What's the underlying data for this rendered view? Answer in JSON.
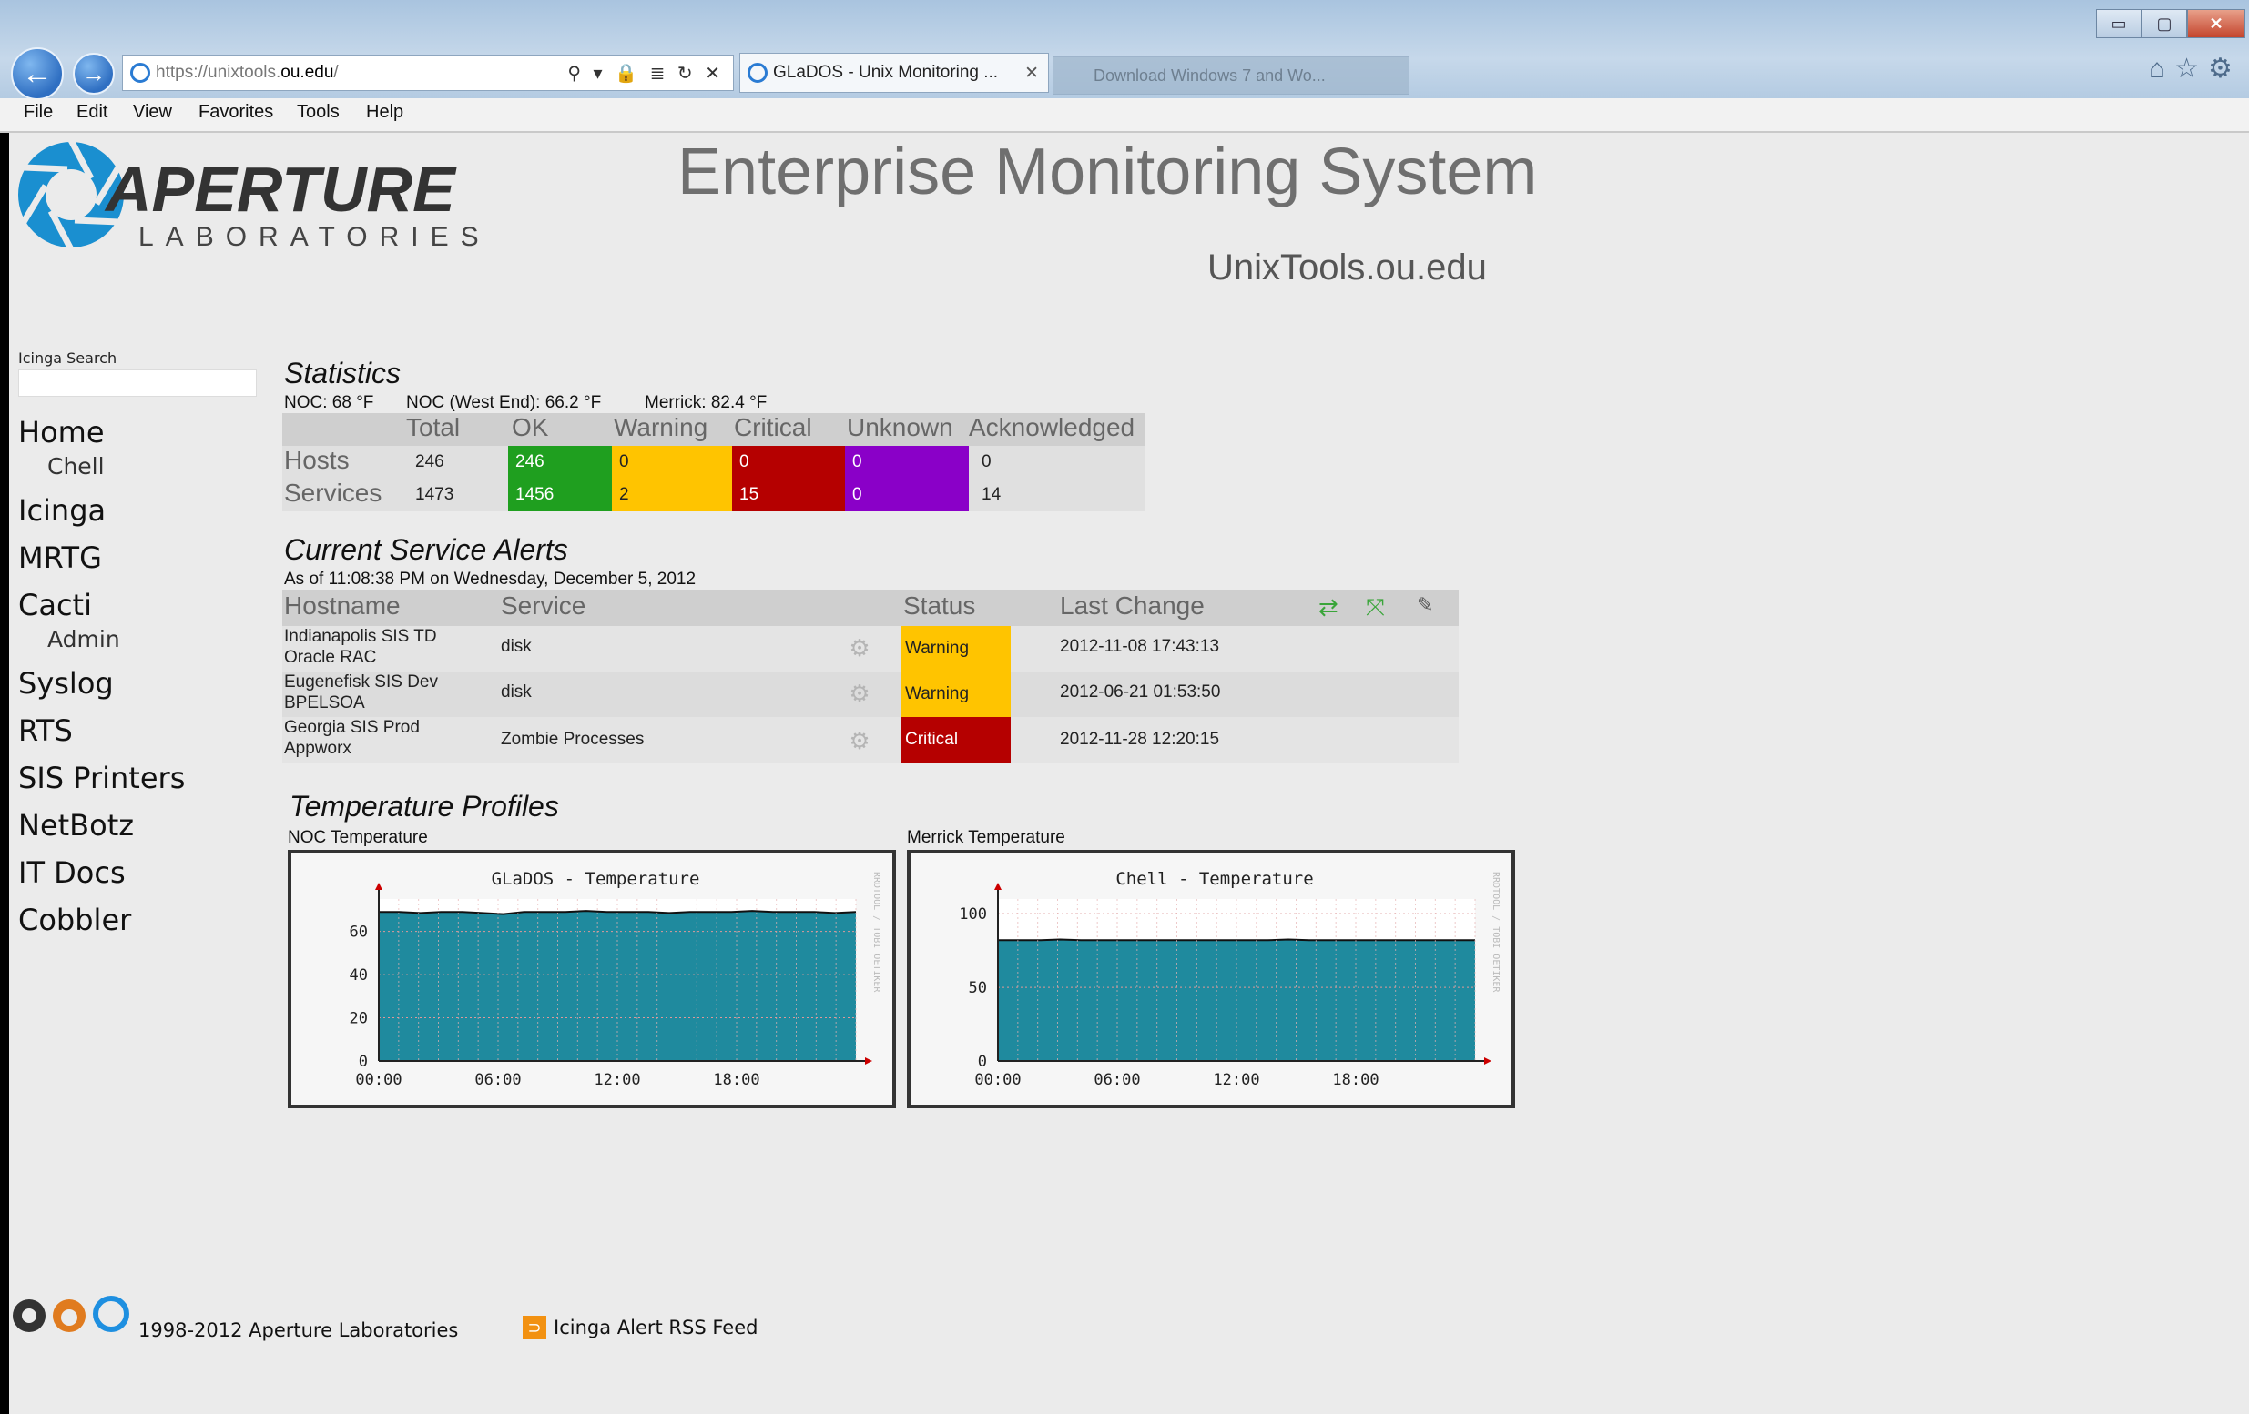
{
  "browser": {
    "url_prefix": "https://unixtools.",
    "url_domain": "ou.edu",
    "url_suffix": "/",
    "address_icons": "⚲ ▾ 🔒 ≣ ↻ ✕",
    "active_tab": "GLaDOS - Unix Monitoring ...",
    "other_tab": "Download Windows 7 and Wo...",
    "menu": [
      "File",
      "Edit",
      "View",
      "Favorites",
      "Tools",
      "Help"
    ],
    "window_buttons": [
      "▭",
      "▢",
      "✕"
    ],
    "toolbar_icons": [
      "home-icon",
      "star-icon",
      "gear-icon"
    ]
  },
  "logo": {
    "word1": "APERTURE",
    "word2": "LABORATORIES"
  },
  "header": {
    "title": "Enterprise Monitoring System",
    "subtitle": "UnixTools.ou.edu"
  },
  "sidebar": {
    "search_label": "Icinga Search",
    "search_value": "",
    "items": [
      {
        "label": "Home"
      },
      {
        "label": "Chell"
      },
      {
        "label": "Icinga"
      },
      {
        "label": "MRTG"
      },
      {
        "label": "Cacti"
      },
      {
        "label": "Admin"
      },
      {
        "label": "Syslog"
      },
      {
        "label": "RTS"
      },
      {
        "label": "SIS Printers"
      },
      {
        "label": "NetBotz"
      },
      {
        "label": "IT Docs"
      },
      {
        "label": "Cobbler"
      }
    ]
  },
  "statistics": {
    "title": "Statistics",
    "temps": [
      "NOC: 68 °F",
      "NOC (West End): 66.2 °F",
      "Merrick: 82.4 °F"
    ],
    "columns": [
      "Total",
      "OK",
      "Warning",
      "Critical",
      "Unknown",
      "Acknowledged"
    ],
    "rows": [
      {
        "label": "Hosts",
        "values": [
          "246",
          "246",
          "0",
          "0",
          "0",
          "0"
        ]
      },
      {
        "label": "Services",
        "values": [
          "1473",
          "1456",
          "2",
          "15",
          "0",
          "14"
        ]
      }
    ],
    "colors": {
      "ok": "#1f9f1f",
      "warning": "#ffc400",
      "critical": "#b50000",
      "unknown": "#8a00c8"
    }
  },
  "alerts": {
    "title": "Current Service Alerts",
    "asof": "As of 11:08:38 PM on Wednesday, December 5, 2012",
    "columns": [
      "Hostname",
      "Service",
      "Status",
      "Last Change"
    ],
    "header_icons": [
      "refresh-icon",
      "expand-icon",
      "edit-icon"
    ],
    "rows": [
      {
        "host1": "Indianapolis SIS TD",
        "host2": "Oracle RAC",
        "service": "disk",
        "status": "Warning",
        "last_change": "2012-11-08 17:43:13"
      },
      {
        "host1": "Eugenefisk SIS Dev",
        "host2": "BPELSOA",
        "service": "disk",
        "status": "Warning",
        "last_change": "2012-06-21 01:53:50"
      },
      {
        "host1": "Georgia SIS Prod",
        "host2": "Appworx",
        "service": "Zombie Processes",
        "status": "Critical",
        "last_change": "2012-11-28 12:20:15"
      }
    ]
  },
  "temperature": {
    "title": "Temperature Profiles",
    "noc_label": "NOC Temperature",
    "merrick_label": "Merrick Temperature"
  },
  "chart_data": [
    {
      "type": "area",
      "title": "GLaDOS - Temperature",
      "x": [
        "00:00",
        "06:00",
        "12:00",
        "18:00"
      ],
      "yticks": [
        0,
        20,
        40,
        60
      ],
      "ylim": [
        0,
        75
      ],
      "values": [
        69,
        69,
        68.5,
        69,
        69,
        68.5,
        68,
        69,
        69,
        69,
        69.5,
        69,
        69,
        69,
        68.5,
        69,
        69,
        69,
        69.5,
        69,
        69,
        69,
        68.5,
        69
      ],
      "side_text": "RRDTOOL / TOBI OETIKER",
      "fill": "#1f8a9e",
      "grid": true
    },
    {
      "type": "area",
      "title": "Chell - Temperature",
      "x": [
        "00:00",
        "06:00",
        "12:00",
        "18:00"
      ],
      "yticks": [
        0,
        50,
        100
      ],
      "ylim": [
        0,
        110
      ],
      "values": [
        82,
        82,
        82,
        82.5,
        82,
        82,
        82,
        82,
        82,
        82,
        82,
        82,
        82,
        82,
        82.5,
        82,
        82,
        82,
        82,
        82,
        82,
        82,
        82,
        82
      ],
      "side_text": "RRDTOOL / TOBI OETIKER",
      "fill": "#1f8a9e",
      "grid": true
    }
  ],
  "footer": {
    "copyright": "1998-2012 Aperture Laboratories",
    "rss": "Icinga Alert RSS Feed"
  }
}
